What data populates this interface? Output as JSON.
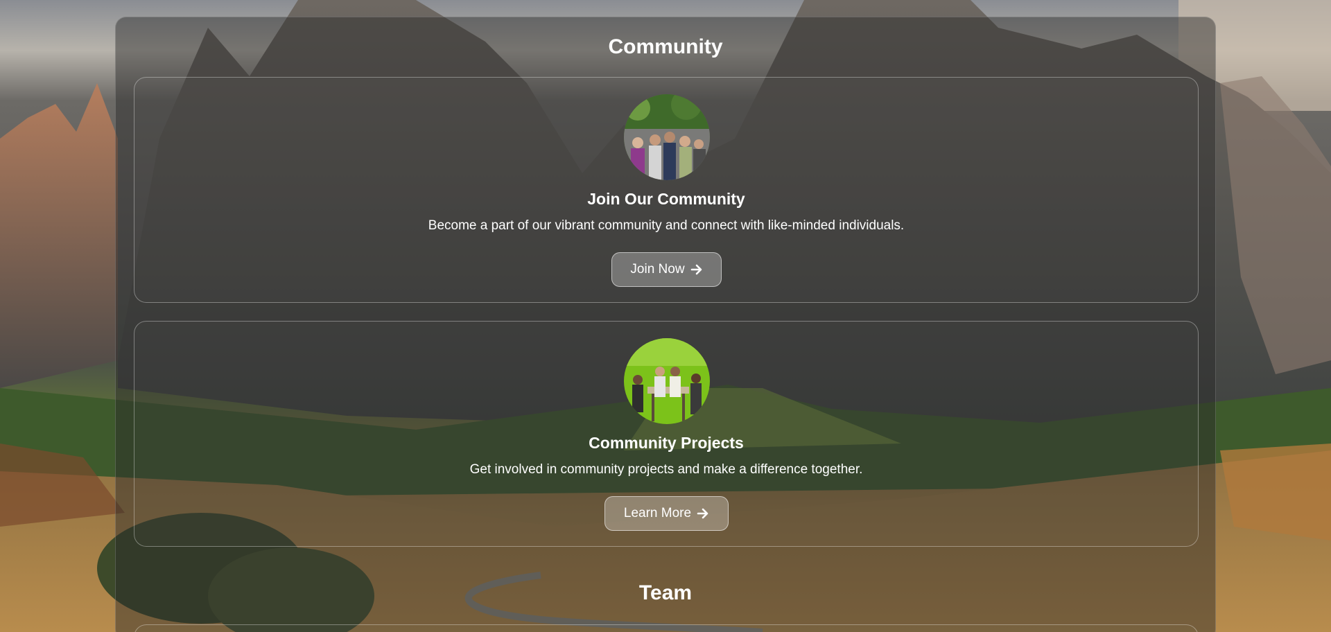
{
  "community": {
    "title": "Community",
    "cards": [
      {
        "title": "Join Our Community",
        "description": "Become a part of our vibrant community and connect with like-minded individuals.",
        "button_label": "Join Now",
        "button_icon": "arrow-right-icon",
        "image": "crowd-photo"
      },
      {
        "title": "Community Projects",
        "description": "Get involved in community projects and make a difference together.",
        "button_label": "Learn More",
        "button_icon": "arrow-right-icon",
        "image": "workshop-photo"
      }
    ]
  },
  "team": {
    "title": "Team"
  },
  "colors": {
    "panel_bg": "rgba(40,40,40,0.45)",
    "text": "#ffffff",
    "button_bg": "rgba(255,255,255,0.28)"
  }
}
